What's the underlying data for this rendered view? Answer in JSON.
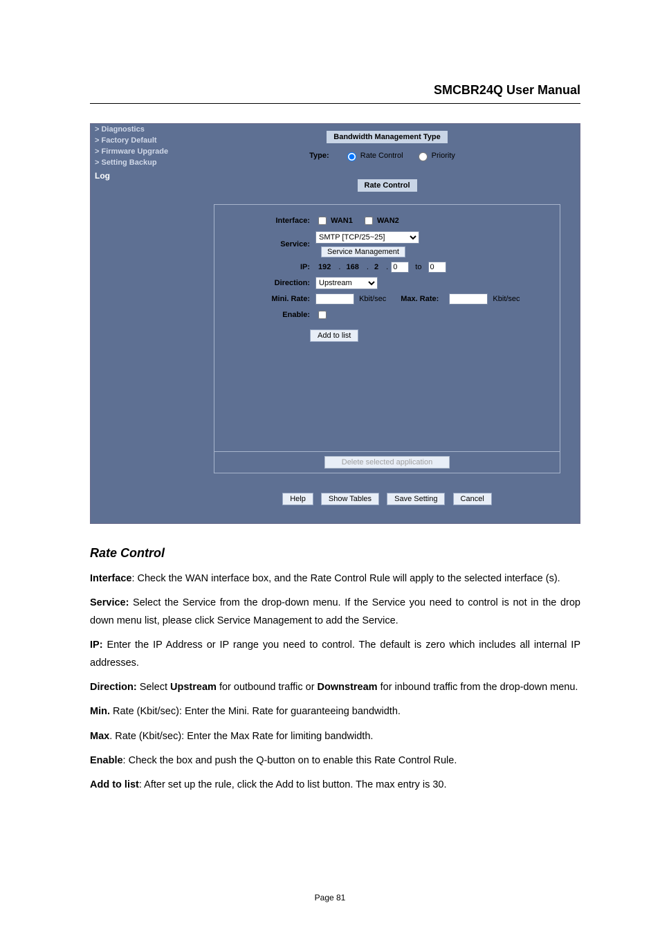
{
  "header": {
    "title": "SMCBR24Q User Manual"
  },
  "sidebar": {
    "items": [
      {
        "label": "> Diagnostics"
      },
      {
        "label": "> Factory Default"
      },
      {
        "label": "> Firmware Upgrade"
      },
      {
        "label": "> Setting Backup"
      }
    ],
    "section": "Log"
  },
  "bmt": {
    "title": "Bandwidth Management Type",
    "type_label": "Type:",
    "opt_rate": "Rate Control",
    "opt_priority": "Priority"
  },
  "rc": {
    "title": "Rate Control",
    "labels": {
      "interface": "Interface:",
      "service": "Service:",
      "ip": "IP:",
      "direction": "Direction:",
      "mini_rate": "Mini. Rate:",
      "enable": "Enable:"
    },
    "wan1": "WAN1",
    "wan2": "WAN2",
    "service_value": "SMTP [TCP/25~25]",
    "service_mgmt_btn": "Service Management",
    "ip_oct1": "192",
    "ip_oct2": "168",
    "ip_oct3": "2",
    "ip_oct4": "0",
    "ip_to": "to",
    "ip_oct5": "0",
    "direction_value": "Upstream",
    "unit": "Kbit/sec",
    "max_rate_label": "Max. Rate:",
    "add_btn": "Add to list",
    "delete_btn": "Delete selected application"
  },
  "buttons": {
    "help": "Help",
    "show_tables": "Show Tables",
    "save": "Save Setting",
    "cancel": "Cancel"
  },
  "doc": {
    "heading": "Rate Control",
    "p1a": "Interface",
    "p1b": ": Check the WAN interface box, and the Rate Control Rule will apply to the selected interface (s).",
    "p2a": "Service:",
    "p2b": " Select the Service from the drop-down menu. If the Service you need to control is not in the drop down menu list, please click Service Management to add the Service.",
    "p3a": "IP:",
    "p3b": " Enter the IP Address or IP range you need to control. The default is zero which includes all internal IP addresses.",
    "p4a": "Direction:",
    "p4b": " Select ",
    "p4c": "Upstream",
    "p4d": " for outbound traffic or ",
    "p4e": "Downstream",
    "p4f": " for inbound traffic from the drop-down menu.",
    "p5a": "Min.",
    "p5b": " Rate (Kbit/sec): Enter the Mini. Rate for guaranteeing bandwidth.",
    "p6a": "Max",
    "p6b": ". Rate (Kbit/sec): Enter the Max Rate for limiting bandwidth.",
    "p7a": "Enable",
    "p7b": ": Check the box and push the Q-button on to enable this Rate Control Rule.",
    "p8a": "Add to list",
    "p8b": ": After set up the rule, click the Add to list button. The max entry is 30."
  },
  "footer": {
    "page": "Page 81"
  }
}
